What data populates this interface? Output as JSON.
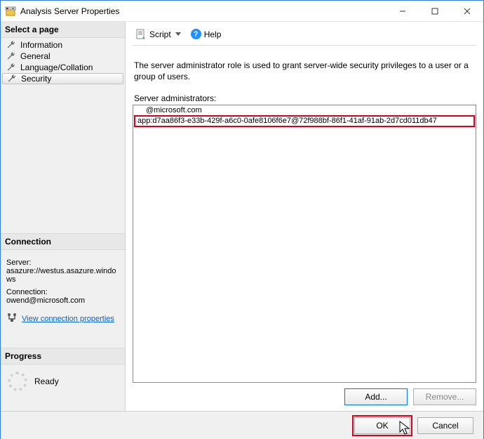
{
  "window": {
    "title": "Analysis Server Properties"
  },
  "left": {
    "select_page": "Select a page",
    "pages": [
      {
        "label": "Information"
      },
      {
        "label": "General"
      },
      {
        "label": "Language/Collation"
      },
      {
        "label": "Security",
        "selected": true
      }
    ],
    "connection": {
      "header": "Connection",
      "server_label": "Server:",
      "server_value": "asazure://westus.asazure.windows",
      "conn_label": "Connection:",
      "conn_value": "owend@microsoft.com",
      "view_props": "View connection properties"
    },
    "progress": {
      "header": "Progress",
      "status": "Ready"
    }
  },
  "toolbar": {
    "script": "Script",
    "help": "Help"
  },
  "main": {
    "description": "The server administrator role is used to grant server-wide security privileges to a user or a group of users.",
    "admins_label": "Server administrators:",
    "admins": [
      {
        "text": "@microsoft.com",
        "highlight": false
      },
      {
        "text": "app:d7aa86f3-e33b-429f-a6c0-0afe8106f6e7@72f988bf-86f1-41af-91ab-2d7cd011db47",
        "highlight": true
      }
    ],
    "add_label": "Add...",
    "remove_label": "Remove..."
  },
  "footer": {
    "ok": "OK",
    "cancel": "Cancel"
  }
}
